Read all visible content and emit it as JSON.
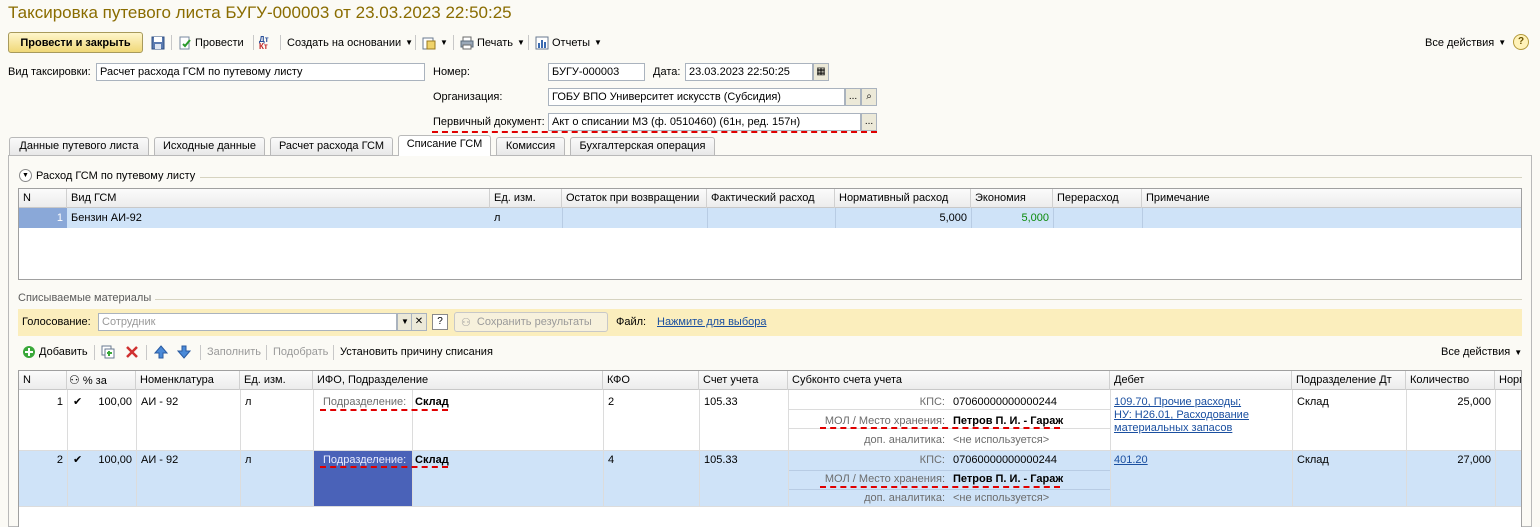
{
  "window": {
    "title": "Таксировка путевого листа БУГУ-000003 от 23.03.2023 22:50:25"
  },
  "toolbar": {
    "post_close": "Провести и закрыть",
    "post": "Провести",
    "create_based": "Создать на основании",
    "print": "Печать",
    "reports": "Отчеты",
    "all_actions": "Все действия",
    "help": "?"
  },
  "form": {
    "taxing_type_label": "Вид таксировки:",
    "taxing_type_value": "Расчет расхода ГСМ по путевому листу",
    "number_label": "Номер:",
    "number_value": "БУГУ-000003",
    "date_label": "Дата:",
    "date_value": "23.03.2023 22:50:25",
    "org_label": "Организация:",
    "org_value": "ГОБУ ВПО Университет искусств (Субсидия)",
    "primary_doc_label": "Первичный документ:",
    "primary_doc_value": "Акт о списании МЗ (ф. 0510460) (61н, ред. 157н)"
  },
  "tabs": [
    {
      "label": "Данные путевого листа"
    },
    {
      "label": "Исходные данные"
    },
    {
      "label": "Расчет расхода ГСМ"
    },
    {
      "label": "Списание ГСМ"
    },
    {
      "label": "Комиссия"
    },
    {
      "label": "Бухгалтерская операция"
    }
  ],
  "fuel_section": {
    "title": "Расход ГСМ по путевому листу",
    "columns": [
      "N",
      "Вид ГСМ",
      "Ед. изм.",
      "Остаток при возвращении",
      "Фактический расход",
      "Нормативный расход",
      "Экономия",
      "Перерасход",
      "Примечание"
    ],
    "rows": [
      {
        "n": "1",
        "fuel": "Бензин АИ-92",
        "unit": "л",
        "remain": "",
        "actual": "",
        "norm": "5,000",
        "economy": "5,000",
        "over": "",
        "note": ""
      }
    ]
  },
  "materials": {
    "title": "Списываемые материалы",
    "voting_label": "Голосование:",
    "voting_placeholder": "Сотрудник",
    "save_results": "Сохранить результаты",
    "file_label": "Файл:",
    "file_link": "Нажмите для выбора",
    "toolbar": {
      "add": "Добавить",
      "fill": "Заполнить",
      "select": "Подобрать",
      "set_reason": "Установить причину списания",
      "all_actions": "Все действия"
    },
    "columns": [
      "N",
      "% за",
      "Номенклатура",
      "Ед. изм.",
      "ИФО, Подразделение",
      "КФО",
      "Счет учета",
      "Субконто счета учета",
      "Дебет",
      "Подразделение Дт",
      "Количество",
      "Норм"
    ],
    "rows": [
      {
        "n": "1",
        "check": "✔",
        "percent": "100,00",
        "item": "АИ - 92",
        "unit": "л",
        "ifo_label": "Подразделение:",
        "ifo_value": "Склад",
        "kfo": "2",
        "account": "105.33",
        "sub": [
          {
            "label": "КПС:",
            "value": "07060000000000244"
          },
          {
            "label": "МОЛ / Место хранения:",
            "value": "Петров П. И. - Гараж"
          },
          {
            "label": "доп. аналитика:",
            "value": "<не используется>"
          }
        ],
        "debit": [
          "109.70, Прочие расходы;",
          "НУ: Н26.01, Расходование",
          "материальных запасов"
        ],
        "dept": "Склад",
        "qty": "25,000"
      },
      {
        "n": "2",
        "check": "✔",
        "percent": "100,00",
        "item": "АИ - 92",
        "unit": "л",
        "ifo_label": "Подразделение:",
        "ifo_value": "Склад",
        "kfo": "4",
        "account": "105.33",
        "sub": [
          {
            "label": "КПС:",
            "value": "07060000000000244"
          },
          {
            "label": "МОЛ / Место хранения:",
            "value": "Петров П. И. - Гараж"
          },
          {
            "label": "доп. аналитика:",
            "value": "<не используется>"
          }
        ],
        "debit": [
          "401.20"
        ],
        "dept": "Склад",
        "qty": "27,000"
      }
    ]
  },
  "colors": {
    "title": "#8a6c00",
    "selection": "#cfe3f8",
    "selected_cell": "#4a62b8",
    "highlight": "#e00000",
    "link": "#1a4fa0"
  }
}
